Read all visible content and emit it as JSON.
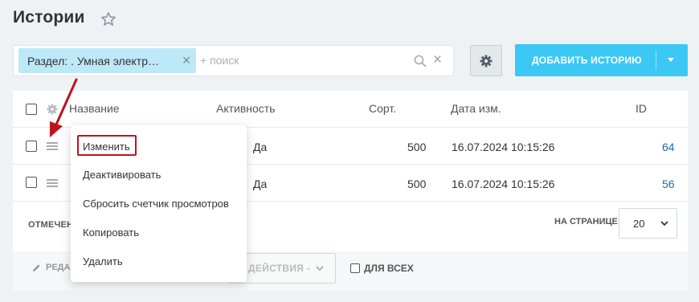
{
  "page": {
    "title": "Истории"
  },
  "filter": {
    "tag": "Раздел: . Умная электр…",
    "placeholder": "+ поиск"
  },
  "toolbar": {
    "add_label": "ДОБАВИТЬ ИСТОРИЮ"
  },
  "grid": {
    "columns": [
      "Название",
      "Активность",
      "Сорт.",
      "Дата изм.",
      "ID"
    ],
    "rows": [
      {
        "active": "Да",
        "sort": "500",
        "date": "16.07.2024 10:15:26",
        "id": "64"
      },
      {
        "active": "Да",
        "sort": "500",
        "date": "16.07.2024 10:15:26",
        "id": "56"
      }
    ],
    "footer_left": "ОТМЕЧЕН",
    "per_page_label": "НА СТРАНИЦЕ:",
    "per_page_value": "20"
  },
  "actions": {
    "edit_label": "РЕДА",
    "select_label": "ДЕЙСТВИЯ -",
    "for_all_label": "ДЛЯ ВСЕХ"
  },
  "context_menu": {
    "items": [
      "Изменить",
      "Деактивировать",
      "Сбросить счетчик просмотров",
      "Копировать",
      "Удалить"
    ]
  },
  "colors": {
    "accent": "#3bc8f5",
    "annotation": "#c0121e",
    "link": "#2067b0"
  }
}
